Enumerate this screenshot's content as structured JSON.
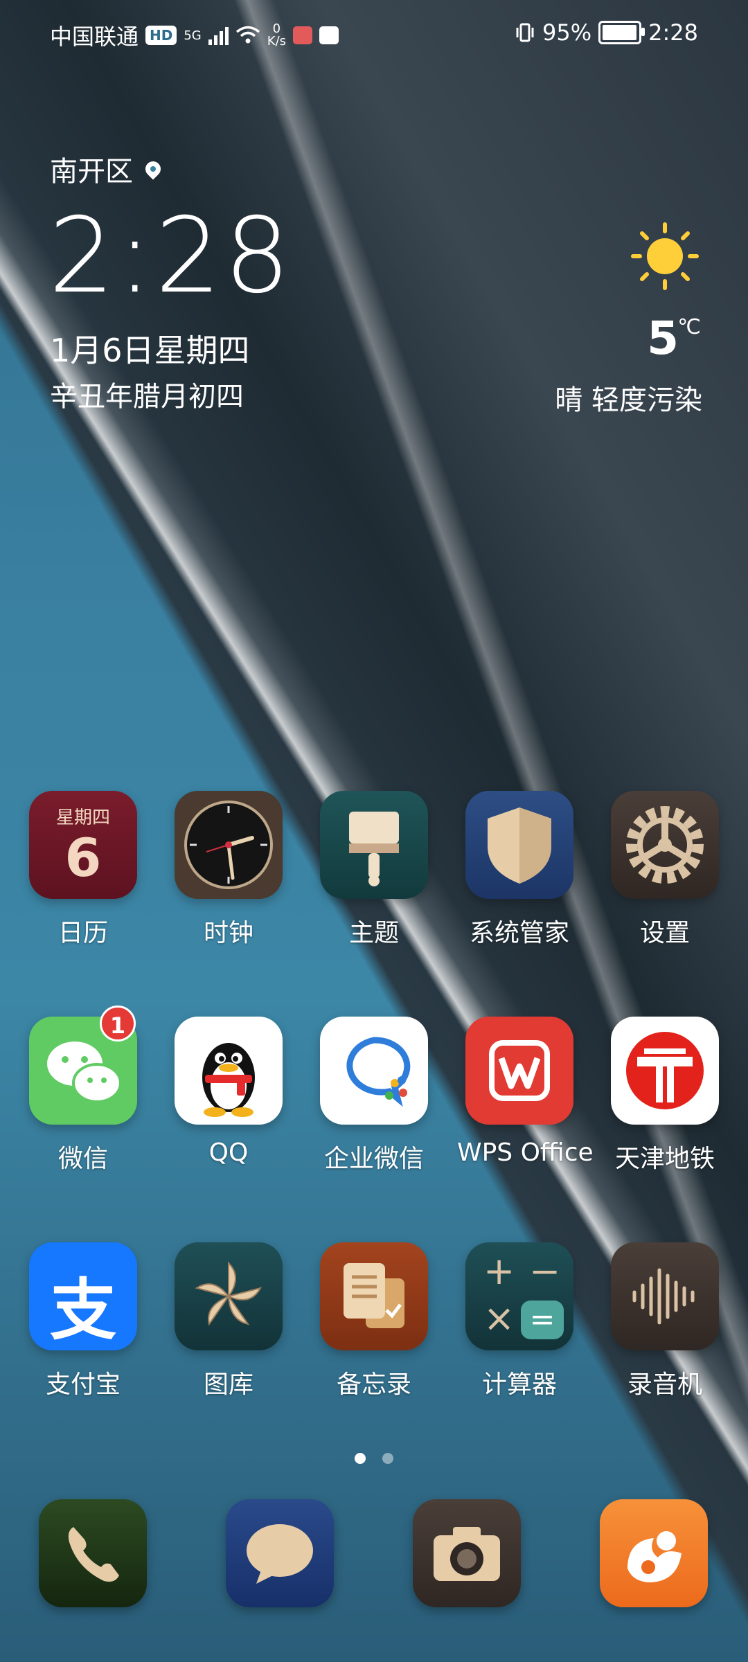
{
  "status_bar": {
    "carrier": "中国联通",
    "hd": "HD",
    "network": "5G",
    "speed_value": "0",
    "speed_unit": "K/s",
    "battery_percent": "95%",
    "time": "2:28"
  },
  "widget": {
    "location": "南开区",
    "time": "2:28",
    "date": "1月6日星期四",
    "lunar": "辛丑年腊月初四",
    "temperature": "5",
    "temp_unit": "℃",
    "condition": "晴  轻度污染"
  },
  "apps": [
    {
      "label": "日历",
      "cal_day": "星期四",
      "cal_date": "6"
    },
    {
      "label": "时钟"
    },
    {
      "label": "主题"
    },
    {
      "label": "系统管家"
    },
    {
      "label": "设置"
    },
    {
      "label": "微信",
      "badge": "1"
    },
    {
      "label": "QQ"
    },
    {
      "label": "企业微信"
    },
    {
      "label": "WPS Office"
    },
    {
      "label": "天津地铁"
    },
    {
      "label": "支付宝",
      "glyph": "支"
    },
    {
      "label": "图库"
    },
    {
      "label": "备忘录"
    },
    {
      "label": "计算器",
      "plus": "+",
      "minus": "−",
      "times": "×",
      "equals": "="
    },
    {
      "label": "录音机"
    }
  ],
  "dock": [
    "phone-icon",
    "messages-icon",
    "camera-icon",
    "uc-browser-icon"
  ],
  "page_indicator": {
    "pages": 2,
    "active": 1
  }
}
